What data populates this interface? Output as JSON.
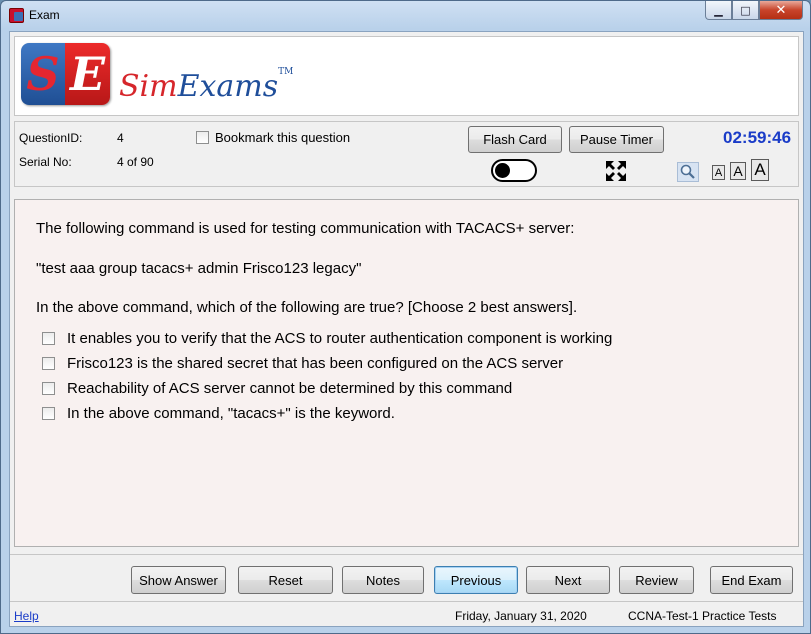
{
  "window": {
    "title": "Exam",
    "controls": {
      "minimize": "▁",
      "maximize": "□",
      "close": "✕"
    }
  },
  "logo": {
    "letter_s": "S",
    "letter_e": "E",
    "word_sim": "Sim",
    "word_exams": "Exams",
    "trademark": "TM"
  },
  "info": {
    "question_id_label": "QuestionID:",
    "question_id_value": "4",
    "serial_label": "Serial No:",
    "serial_value": "4 of 90",
    "bookmark_label": "Bookmark this question",
    "flash_card": "Flash Card",
    "pause_timer": "Pause Timer",
    "timer": "02:59:46",
    "font_small": "A",
    "font_medium": "A",
    "font_large": "A"
  },
  "question": {
    "line1": "The following command is used for testing communication with TACACS+ server:",
    "line2": "\"test aaa group tacacs+ admin Frisco123 legacy\"",
    "line3": "In the above command, which of the following are true? [Choose 2 best answers].",
    "options": [
      {
        "text": "It enables you to verify that the ACS to router authentication component is working",
        "checked": false
      },
      {
        "text": "Frisco123 is the shared secret that has been configured on the ACS server",
        "checked": false
      },
      {
        "text": "Reachability of ACS server cannot be determined by this command",
        "checked": false
      },
      {
        "text": "In the above command, \"tacacs+\" is the keyword.",
        "checked": false
      }
    ]
  },
  "nav": {
    "show_answer": "Show Answer",
    "reset": "Reset",
    "notes": "Notes",
    "previous": "Previous",
    "next": "Next",
    "review": "Review",
    "end_exam": "End Exam"
  },
  "status": {
    "help": "Help",
    "date": "Friday, January 31, 2020",
    "product": "CCNA-Test-1 Practice Tests"
  },
  "icons": {
    "app": "app-icon",
    "expand": "expand-icon",
    "search": "search-icon",
    "toggle": "toggle-switch"
  }
}
